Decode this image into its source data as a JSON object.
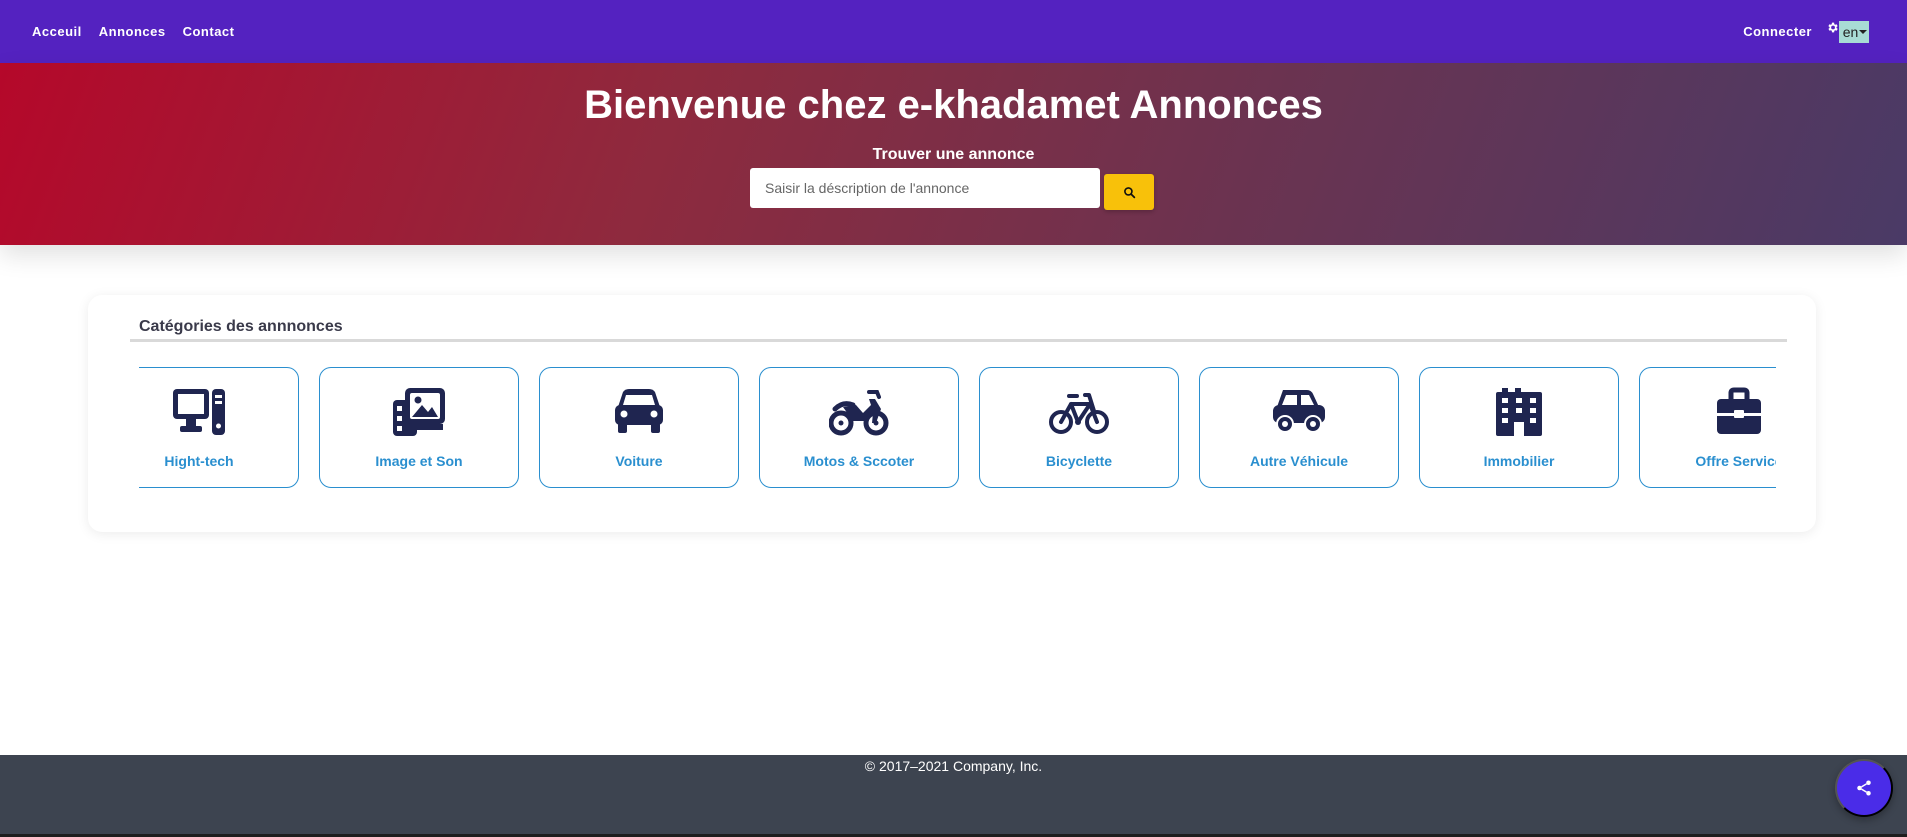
{
  "nav": {
    "links": [
      "Acceuil",
      "Annonces",
      "Contact"
    ],
    "login_label": "Connecter",
    "language": "en"
  },
  "hero": {
    "title": "Bienvenue chez e-khadamet Annonces",
    "subtitle": "Trouver une annonce",
    "search_placeholder": "Saisir la déscription de l'annonce"
  },
  "categories": {
    "title": "Catégories des annnonces",
    "items": [
      {
        "label": "Hight-tech",
        "icon": "desktop-computer-icon"
      },
      {
        "label": "Image et Son",
        "icon": "photo-gallery-icon"
      },
      {
        "label": "Voiture",
        "icon": "car-icon"
      },
      {
        "label": "Motos & Sccoter",
        "icon": "motorcycle-icon"
      },
      {
        "label": "Bicyclette",
        "icon": "bicycle-icon"
      },
      {
        "label": "Autre Véhicule",
        "icon": "car-side-icon"
      },
      {
        "label": "Immobilier",
        "icon": "building-icon"
      },
      {
        "label": "Offre Service",
        "icon": "briefcase-icon"
      }
    ]
  },
  "footer": {
    "copyright": "© 2017–2021 Company, Inc."
  },
  "colors": {
    "navbar": "#5422c0",
    "accent_blue": "#2a8fcf",
    "icon_dark": "#1f2550",
    "search_button": "#f8c10a",
    "footer": "#3d4450",
    "share_button": "#4a2ce8"
  }
}
